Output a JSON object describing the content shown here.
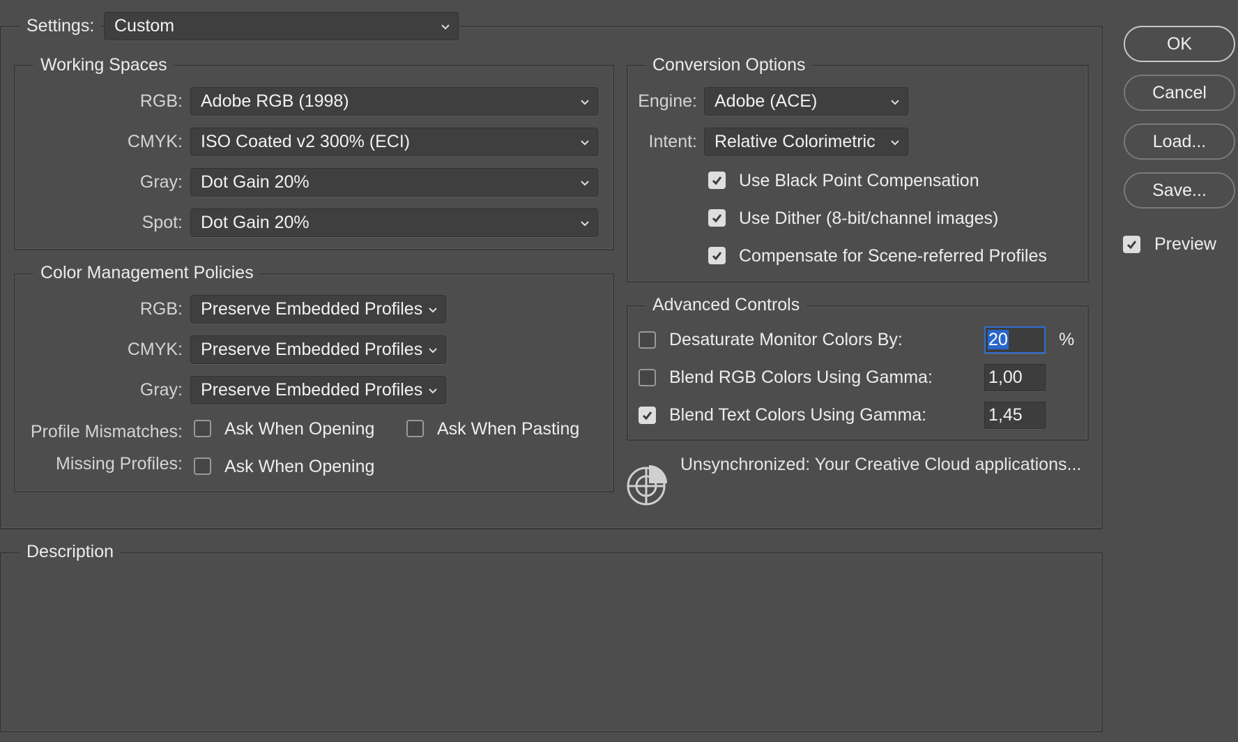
{
  "settings": {
    "label": "Settings:",
    "value": "Custom"
  },
  "working_spaces": {
    "title": "Working Spaces",
    "rgb": {
      "label": "RGB:",
      "value": "Adobe RGB (1998)"
    },
    "cmyk": {
      "label": "CMYK:",
      "value": "ISO Coated v2 300% (ECI)"
    },
    "gray": {
      "label": "Gray:",
      "value": "Dot Gain 20%"
    },
    "spot": {
      "label": "Spot:",
      "value": "Dot Gain 20%"
    }
  },
  "policies": {
    "title": "Color Management Policies",
    "rgb": {
      "label": "RGB:",
      "value": "Preserve Embedded Profiles"
    },
    "cmyk": {
      "label": "CMYK:",
      "value": "Preserve Embedded Profiles"
    },
    "gray": {
      "label": "Gray:",
      "value": "Preserve Embedded Profiles"
    },
    "profile_mismatches": {
      "label": "Profile Mismatches:",
      "ask_opening": {
        "label": "Ask When Opening",
        "checked": false
      },
      "ask_pasting": {
        "label": "Ask When Pasting",
        "checked": false
      }
    },
    "missing_profiles": {
      "label": "Missing Profiles:",
      "ask_opening": {
        "label": "Ask When Opening",
        "checked": false
      }
    }
  },
  "conversion": {
    "title": "Conversion Options",
    "engine": {
      "label": "Engine:",
      "value": "Adobe (ACE)"
    },
    "intent": {
      "label": "Intent:",
      "value": "Relative Colorimetric"
    },
    "black_point": {
      "label": "Use Black Point Compensation",
      "checked": true
    },
    "dither": {
      "label": "Use Dither (8-bit/channel images)",
      "checked": true
    },
    "scene_referred": {
      "label": "Compensate for Scene-referred Profiles",
      "checked": true
    }
  },
  "advanced": {
    "title": "Advanced Controls",
    "desaturate": {
      "label": "Desaturate Monitor Colors By:",
      "checked": false,
      "value": "20",
      "unit": "%"
    },
    "blend_rgb": {
      "label": "Blend RGB Colors Using Gamma:",
      "checked": false,
      "value": "1,00"
    },
    "blend_text": {
      "label": "Blend Text Colors Using Gamma:",
      "checked": true,
      "value": "1,45"
    }
  },
  "sync": {
    "icon": "sync-status-icon",
    "text": "Unsynchronized: Your Creative Cloud applications..."
  },
  "description": {
    "title": "Description"
  },
  "buttons": {
    "ok": "OK",
    "cancel": "Cancel",
    "load": "Load...",
    "save": "Save..."
  },
  "preview": {
    "label": "Preview",
    "checked": true
  },
  "colors": {
    "background": "#4d4d4d",
    "control": "#3f3f3f",
    "focus": "#2f6fd6"
  }
}
